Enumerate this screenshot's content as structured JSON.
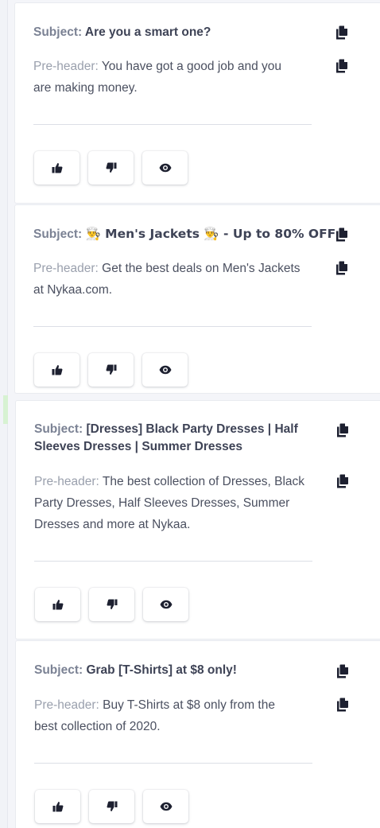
{
  "labels": {
    "subject": "Subject:",
    "preheader": "Pre-header:"
  },
  "icons": {
    "copy": "copy-icon",
    "like": "thumbs-up-icon",
    "dislike": "thumbs-down-icon",
    "preview": "eye-icon"
  },
  "colors": {
    "label": "#7b8294",
    "preheader_label": "#9aa0ad",
    "text": "#3e4356",
    "card_bg": "#ffffff",
    "page_bg": "#f4f5f9"
  },
  "cards": [
    {
      "subject_lines": [
        "Are you a smart one?"
      ],
      "preheader_lines": [
        " You have got a good job and you",
        "are making money."
      ]
    },
    {
      "subject_lines": [
        "👨‍🍳 Men's Jackets 👨‍🍳 - Up to 80% OFF"
      ],
      "preheader_lines": [
        " Get the best deals on Men's Jackets",
        "at Nykaa.com."
      ]
    },
    {
      "subject_lines": [
        "[Dresses] Black Party Dresses | Half",
        "Sleeves Dresses | Summer Dresses"
      ],
      "preheader_lines": [
        " The best collection of Dresses, Black",
        "Party Dresses, Half Sleeves Dresses, Summer",
        "Dresses and more at Nykaa."
      ]
    },
    {
      "subject_lines": [
        "Grab [T-Shirts] at $8 only!"
      ],
      "preheader_lines": [
        " Buy T-Shirts at $8 only from the",
        "best collection of 2020."
      ]
    }
  ]
}
